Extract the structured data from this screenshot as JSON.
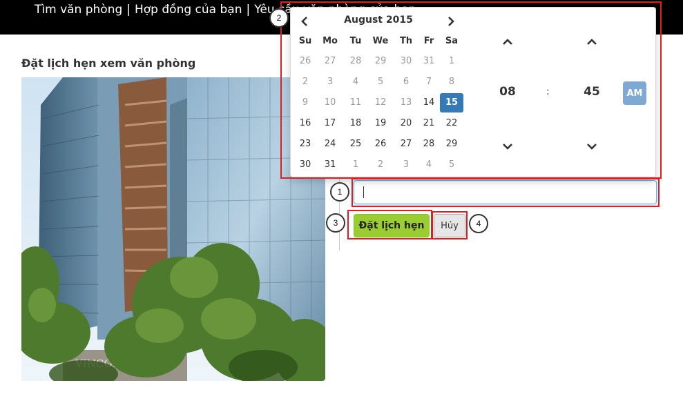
{
  "nav": {
    "items": [
      "Tìm văn phòng",
      "Hợp đồng của bạn",
      "Yêu cầu văn phòng của bạn"
    ],
    "separator": "|"
  },
  "page": {
    "title": "Đặt lịch hẹn xem văn phòng"
  },
  "photo": {
    "sign_text": "VINCOM CEN"
  },
  "datetime_input": {
    "value": ""
  },
  "buttons": {
    "submit_label": "Đặt lịch hẹn",
    "cancel_label": "Hủy"
  },
  "picker": {
    "month_label": "August 2015",
    "weekdays": [
      "Su",
      "Mo",
      "Tu",
      "We",
      "Th",
      "Fr",
      "Sa"
    ],
    "weeks": [
      [
        "26",
        "27",
        "28",
        "29",
        "30",
        "31",
        "1"
      ],
      [
        "2",
        "3",
        "4",
        "5",
        "6",
        "7",
        "8"
      ],
      [
        "9",
        "10",
        "11",
        "12",
        "13",
        "14",
        "15"
      ],
      [
        "16",
        "17",
        "18",
        "19",
        "20",
        "21",
        "22"
      ],
      [
        "23",
        "24",
        "25",
        "26",
        "27",
        "28",
        "29"
      ],
      [
        "30",
        "31",
        "1",
        "2",
        "3",
        "4",
        "5"
      ]
    ],
    "muted_days": [
      [
        true,
        true,
        true,
        true,
        true,
        true,
        true
      ],
      [
        true,
        true,
        true,
        true,
        true,
        true,
        true
      ],
      [
        true,
        true,
        true,
        true,
        true,
        false,
        false
      ],
      [
        false,
        false,
        false,
        false,
        false,
        false,
        false
      ],
      [
        false,
        false,
        false,
        false,
        false,
        false,
        false
      ],
      [
        false,
        false,
        true,
        true,
        true,
        true,
        true
      ]
    ],
    "selected_day": "15",
    "hour": "08",
    "time_separator": ":",
    "minute": "45",
    "period": "AM",
    "icons": {
      "prev": "chevron-left-icon",
      "next": "chevron-right-icon",
      "up": "chevron-up-icon",
      "down": "chevron-down-icon"
    }
  },
  "annotations": {
    "labels": [
      "1",
      "2",
      "3",
      "4"
    ],
    "color": "#e01e1e"
  },
  "colors": {
    "accent": "#337ab7",
    "submit": "#9acd32",
    "topbar": "#000000",
    "ampm": "#7fa9d3"
  }
}
